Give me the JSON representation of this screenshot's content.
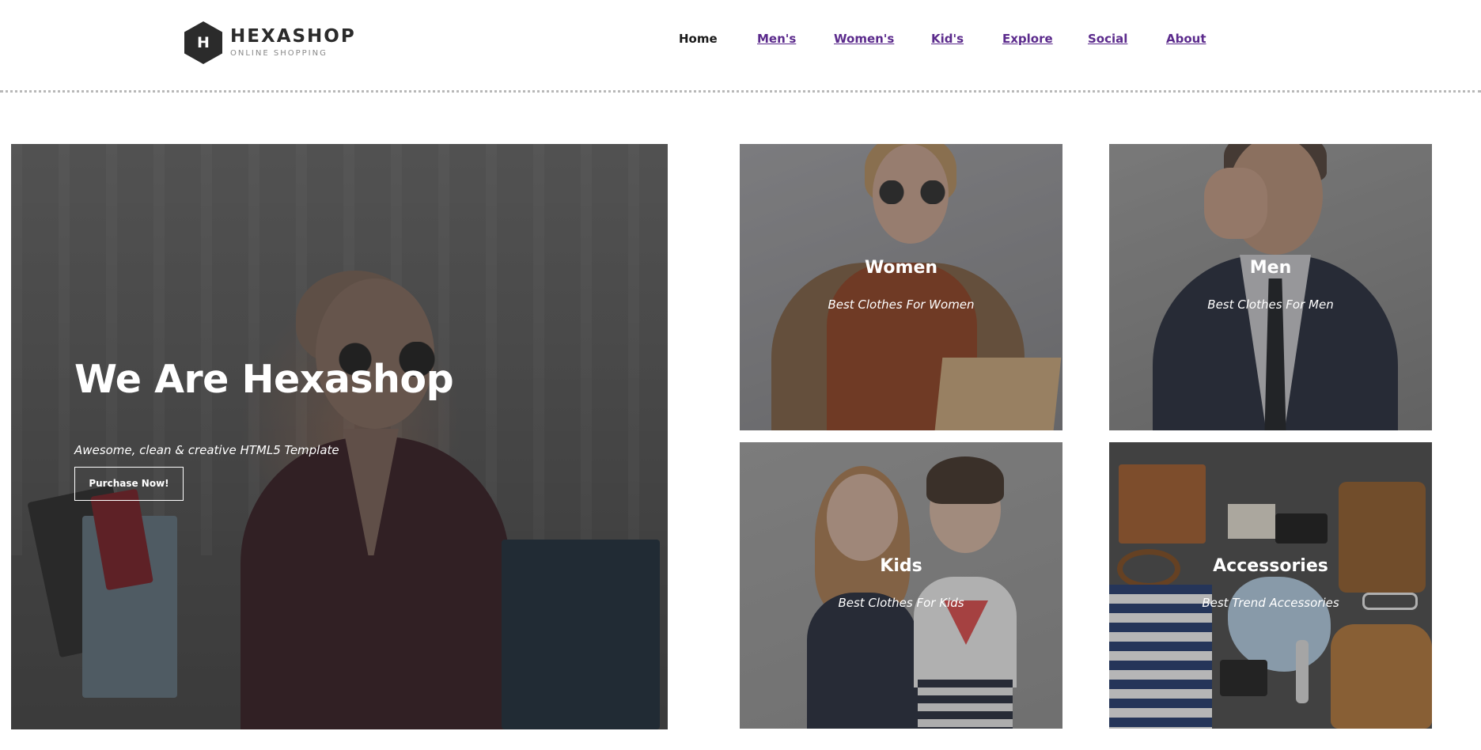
{
  "brand": {
    "logo_letter": "H",
    "name": "HEXASHOP",
    "tagline": "ONLINE SHOPPING"
  },
  "nav": {
    "items": [
      {
        "label": "Home",
        "active": true
      },
      {
        "label": "Men's",
        "active": false
      },
      {
        "label": "Women's",
        "active": false
      },
      {
        "label": "Kid's",
        "active": false
      },
      {
        "label": "Explore",
        "active": false
      },
      {
        "label": "Social",
        "active": false
      },
      {
        "label": "About",
        "active": false
      }
    ]
  },
  "hero": {
    "title": "We Are Hexashop",
    "subtitle": "Awesome, clean & creative HTML5 Template",
    "button_label": "Purchase Now!"
  },
  "categories": [
    {
      "title": "Women",
      "subtitle": "Best Clothes For Women"
    },
    {
      "title": "Men",
      "subtitle": "Best Clothes For Men"
    },
    {
      "title": "Kids",
      "subtitle": "Best Clothes For Kids"
    },
    {
      "title": "Accessories",
      "subtitle": "Best Trend Accessories"
    }
  ],
  "colors": {
    "nav_link": "#5b2a8c",
    "nav_active": "#1a1a1a",
    "logo_dark": "#2b2b2b"
  }
}
